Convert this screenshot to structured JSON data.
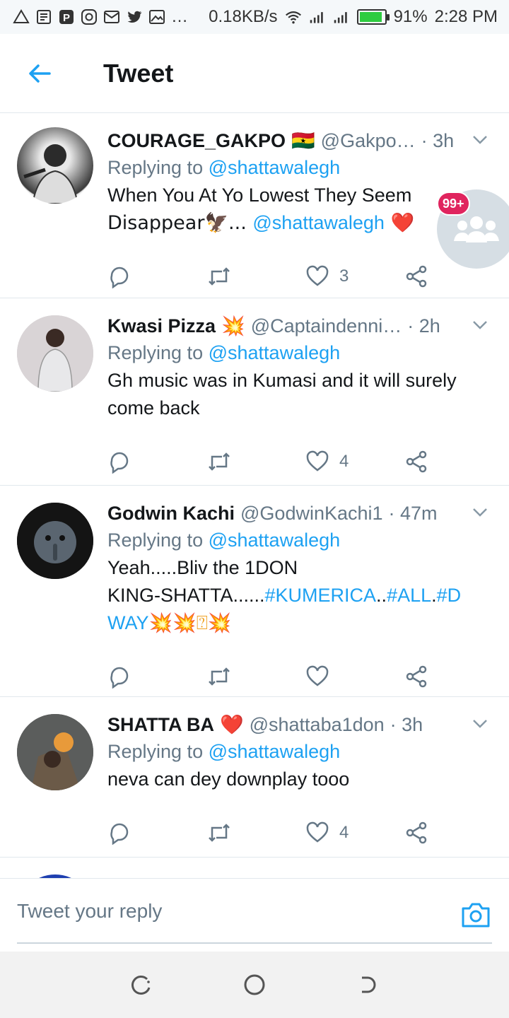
{
  "status_bar": {
    "net_speed": "0.18KB/s",
    "battery_pct": "91%",
    "battery_level": 0.91,
    "time": "2:28 PM",
    "more": "…"
  },
  "header": {
    "title": "Tweet"
  },
  "tweets": [
    {
      "name": "COURAGE_GAKPO",
      "name_emoji": "🇬🇭",
      "handle": "@Gakpo…",
      "time": "· 3h",
      "replying_prefix": "Replying to",
      "replying_to": "@shattawalegh",
      "text_line1": "When You At Yo Lowest They Seem",
      "text_line2a": "Disappear🦅... ",
      "text_line2_link": "@shattawalegh",
      "text_line2b": " ❤️",
      "likes": "3"
    },
    {
      "name": "Kwasi Pizza",
      "name_emoji": "💥",
      "handle": "@Captaindenni…",
      "time": "· 2h",
      "replying_prefix": "Replying to",
      "replying_to": "@shattawalegh",
      "text": "Gh music was in Kumasi and it will surely come back",
      "likes": "4"
    },
    {
      "name": "Godwin Kachi",
      "handle": "@GodwinKachi1",
      "time": "· 47m",
      "replying_prefix": "Replying to",
      "replying_to": "@shattawalegh",
      "text_line1": "Yeah.....Bliv the  1DON",
      "text_line2a": "KING-SHATTA......",
      "text_line2_link1": "#KUMERICA",
      "text_line2_mid": "..",
      "text_line2_link2": "#ALL",
      "text_line2_dot": ".",
      "text_line2_link3": "#D",
      "text_line3_link": "WAY",
      "text_line3_emoji": "💥💥⍰💥",
      "likes": ""
    },
    {
      "name": "SHATTA BA",
      "name_emoji": "❤️",
      "handle": "@shattaba1don",
      "time": "· 3h",
      "replying_prefix": "Replying to",
      "replying_to": "@shattawalegh",
      "text": "neva can dey downplay tooo",
      "likes": "4"
    }
  ],
  "floating": {
    "badge": "99+"
  },
  "composer": {
    "placeholder": "Tweet your reply"
  },
  "icons": {
    "back": "arrow-left-icon",
    "caret": "chevron-down-icon",
    "reply": "reply-icon",
    "retweet": "retweet-icon",
    "like": "heart-icon",
    "share": "share-icon",
    "camera": "camera-icon"
  },
  "colors": {
    "accent": "#1da1f2",
    "muted": "#657786",
    "badge": "#e0245e"
  }
}
